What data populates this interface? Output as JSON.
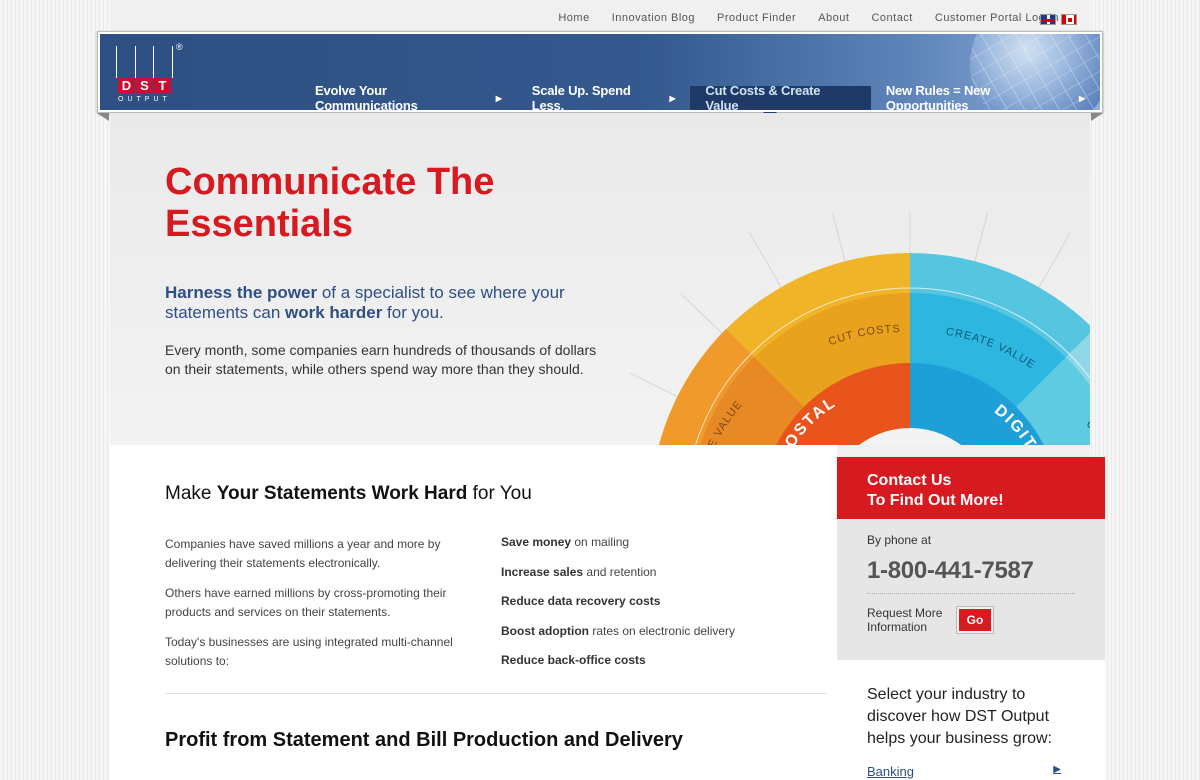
{
  "topnav": {
    "items": [
      "Home",
      "Innovation Blog",
      "Product Finder",
      "About",
      "Contact",
      "Customer Portal Log In"
    ]
  },
  "logo": {
    "letters": [
      "D",
      "S",
      "T"
    ],
    "sub": "OUTPUT",
    "reg": "®"
  },
  "mainnav": {
    "items": [
      {
        "label": "Evolve Your Communications",
        "arrow": "▶"
      },
      {
        "label": "Scale Up. Spend Less.",
        "arrow": "▶"
      },
      {
        "label": "Cut Costs & Create Value",
        "arrow": ""
      },
      {
        "label": "New Rules = New Opportunities",
        "arrow": "▶"
      }
    ]
  },
  "hero": {
    "title": "Communicate The Essentials",
    "lead_b1": "Harness the power",
    "lead_t1": " of a specialist to see where your statements can ",
    "lead_b2": "work harder",
    "lead_t2": " for you.",
    "body": "Every month, some companies earn hundreds of thousands of dollars on their statements, while others spend way more than they should.",
    "wheel": {
      "postal": "POSTAL",
      "digital": "DIGITAL",
      "create_value": "CREATE VALUE",
      "cut_costs": "CUT COSTS"
    }
  },
  "content": {
    "h2_pre": "Make ",
    "h2_b": "Your Statements Work Hard",
    "h2_post": " for You",
    "left": [
      "Companies have saved millions a year and more by delivering their statements electronically.",
      "Others have earned millions by cross-promoting their products and services on their statements.",
      "Today's businesses are using integrated multi-channel solutions to:"
    ],
    "right": [
      {
        "b": "Save money",
        "t": " on mailing"
      },
      {
        "b": "Increase sales",
        "t": " and retention"
      },
      {
        "b": "Reduce data recovery costs",
        "t": ""
      },
      {
        "b": "Boost adoption",
        "t": " rates on electronic delivery"
      },
      {
        "b": "Reduce back-office costs",
        "t": ""
      }
    ],
    "h3_b1": "Profit",
    "h3_t": " from Statement and Bill ",
    "h3_b2": "Production and Delivery"
  },
  "sidebar": {
    "contact_l1": "Contact Us",
    "contact_l2": "To Find Out More!",
    "phone_label": "By phone at",
    "phone": "1-800-441-7587",
    "req_label": "Request More Information",
    "go": "Go",
    "industry_text": "Select your industry to discover how DST Output helps your business grow:",
    "industry_link": "Banking",
    "chev": "▶"
  },
  "colors": {
    "brand_red": "#d71920",
    "brand_blue": "#2e4f82"
  }
}
